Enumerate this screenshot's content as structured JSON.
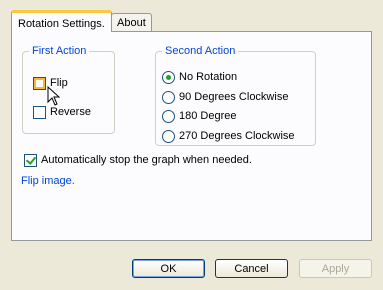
{
  "tabs": [
    {
      "label": "Rotation Settings."
    },
    {
      "label": "About"
    }
  ],
  "first_action": {
    "title": "First Action",
    "flip_label": "Flip",
    "flip_checked": false,
    "reverse_label": "Reverse",
    "reverse_checked": false
  },
  "second_action": {
    "title": "Second Action",
    "options": [
      "No Rotation",
      "90 Degrees Clockwise",
      "180 Degree",
      "270 Degrees Clockwise"
    ],
    "selected": "No Rotation"
  },
  "auto_stop": {
    "label": "Automatically stop the graph when needed.",
    "checked": true
  },
  "description": "Flip image.",
  "buttons": {
    "ok": "OK",
    "cancel": "Cancel",
    "apply": "Apply"
  }
}
